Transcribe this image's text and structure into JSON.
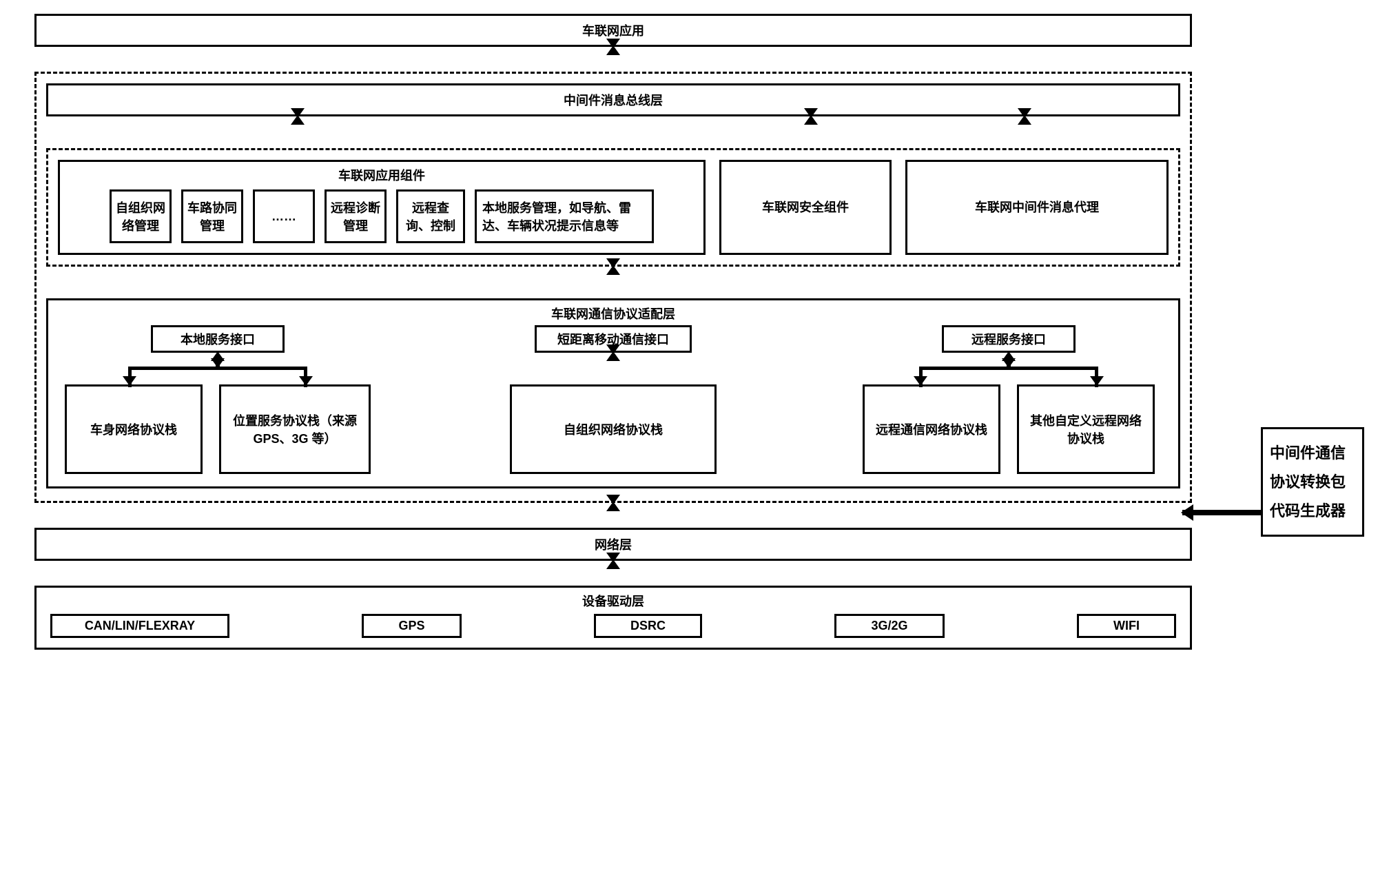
{
  "layers": {
    "app_layer": "车联网应用",
    "middleware_bus": "中间件消息总线层",
    "app_components": {
      "title": "车联网应用组件",
      "items": [
        "自组织网络管理",
        "车路协同管理",
        "……",
        "远程诊断管理",
        "远程查询、控制",
        "本地服务管理，如导航、雷达、车辆状况提示信息等"
      ]
    },
    "security_component": "车联网安全组件",
    "message_proxy": "车联网中间件消息代理",
    "protocol_adapter": {
      "title": "车联网通信协议适配层",
      "local": {
        "title": "本地服务接口",
        "stacks": [
          "车身网络协议栈",
          "位置服务协议栈（来源 GPS、3G 等）"
        ]
      },
      "short_range": {
        "title": "短距离移动通信接口",
        "stacks": [
          "自组织网络协议栈"
        ]
      },
      "remote": {
        "title": "远程服务接口",
        "stacks": [
          "远程通信网络协议栈",
          "其他自定义远程网络协议栈"
        ]
      }
    },
    "network_layer": "网络层",
    "driver_layer": {
      "title": "设备驱动层",
      "items": [
        "CAN/LIN/FLEXRAY",
        "GPS",
        "DSRC",
        "3G/2G",
        "WIFI"
      ]
    }
  },
  "side": {
    "codegen": "中间件通信协议转换包代码生成器"
  }
}
